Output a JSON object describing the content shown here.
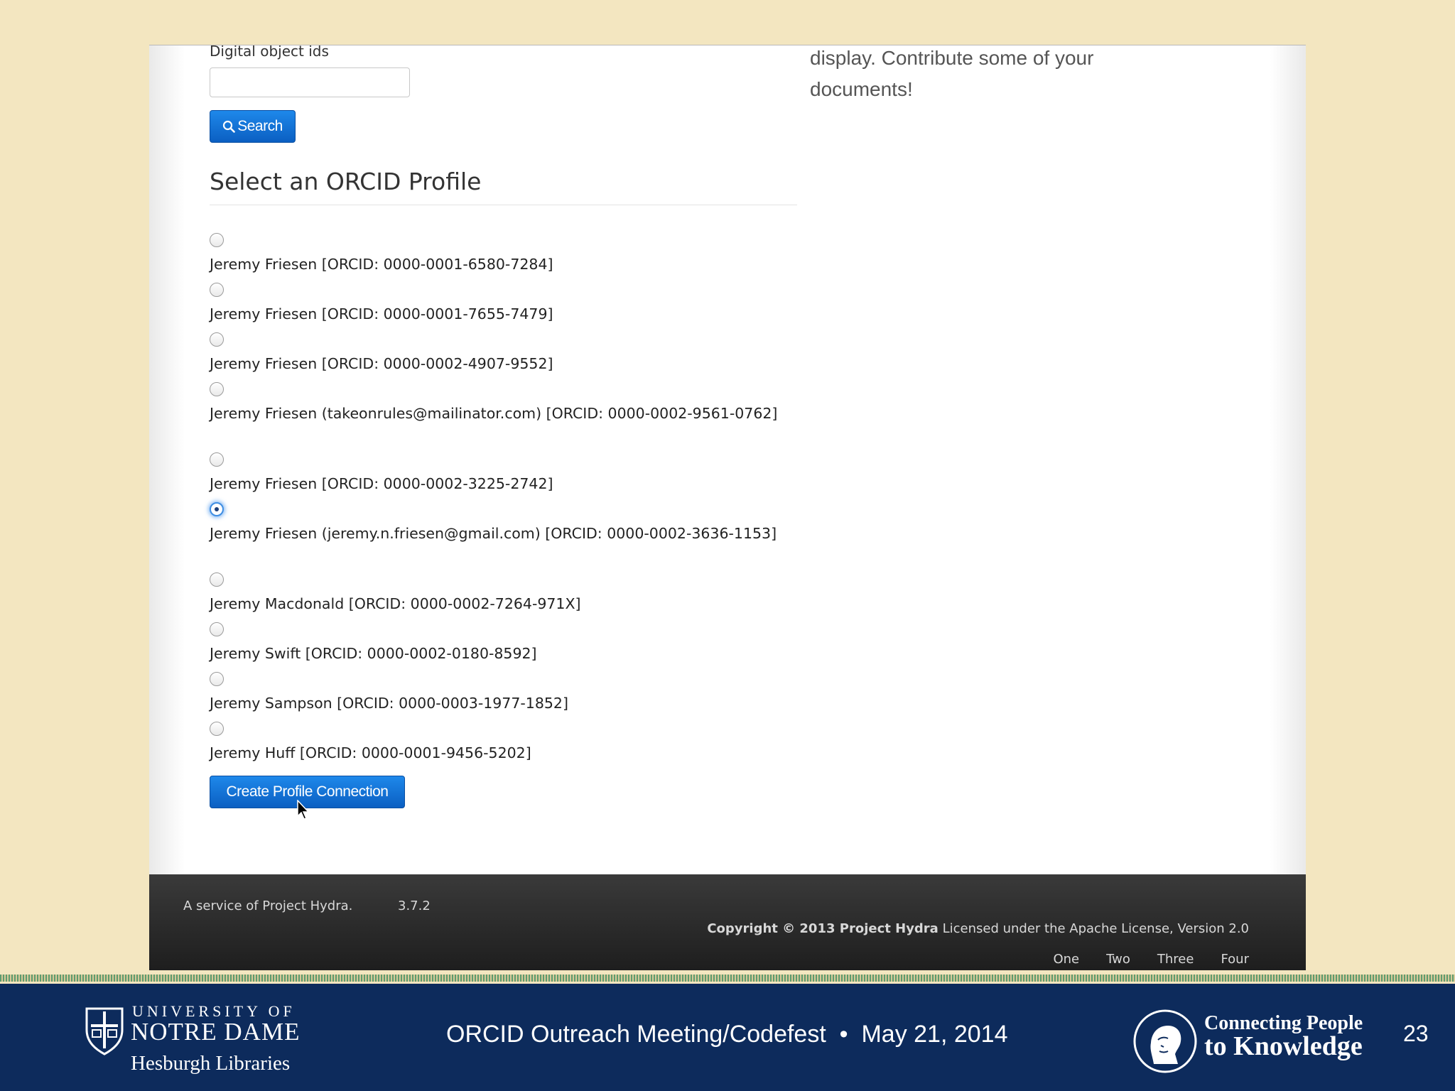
{
  "form": {
    "digital_object_ids_label": "Digital object ids",
    "digital_object_ids_value": "",
    "search_button_label": "Search",
    "section_title": "Select an ORCID Profile",
    "create_button_label": "Create Profile Connection"
  },
  "sidebar": {
    "message": "display. Contribute some of your documents!"
  },
  "profiles": [
    {
      "label": "Jeremy Friesen [ORCID: 0000-0001-6580-7284]",
      "checked": false
    },
    {
      "label": "Jeremy Friesen [ORCID: 0000-0001-7655-7479]",
      "checked": false
    },
    {
      "label": "Jeremy Friesen [ORCID: 0000-0002-4907-9552]",
      "checked": false
    },
    {
      "label": "Jeremy Friesen (takeonrules@mailinator.com) [ORCID: 0000-0002-9561-0762]",
      "checked": false
    },
    {
      "label": "Jeremy Friesen [ORCID: 0000-0002-3225-2742]",
      "checked": false
    },
    {
      "label": "Jeremy Friesen (jeremy.n.friesen@gmail.com) [ORCID: 0000-0002-3636-1153]",
      "checked": true
    },
    {
      "label": "Jeremy Macdonald [ORCID: 0000-0002-7264-971X]",
      "checked": false
    },
    {
      "label": "Jeremy Swift [ORCID: 0000-0002-0180-8592]",
      "checked": false
    },
    {
      "label": "Jeremy Sampson [ORCID: 0000-0003-1977-1852]",
      "checked": false
    },
    {
      "label": "Jeremy Huff [ORCID: 0000-0001-9456-5202]",
      "checked": false
    }
  ],
  "footer": {
    "service": "A service of Project Hydra.",
    "version": "3.7.2",
    "copyright_bold": "Copyright © 2013 Project Hydra",
    "license": "Licensed under the Apache License, Version 2.0",
    "links": [
      "One",
      "Two",
      "Three",
      "Four"
    ]
  },
  "slide": {
    "university_of": "UNIVERSITY OF",
    "university_name": "NOTRE DAME",
    "library": "Hesburgh Libraries",
    "meeting": "ORCID Outreach Meeting/Codefest  •  May 21, 2014",
    "tagline_line1": "Connecting People",
    "tagline_line2": "to Knowledge",
    "slide_number": "23"
  },
  "colors": {
    "slide_background": "#f3e6c0",
    "banner": "#0d2b5c",
    "button": "#0b6ad6"
  }
}
